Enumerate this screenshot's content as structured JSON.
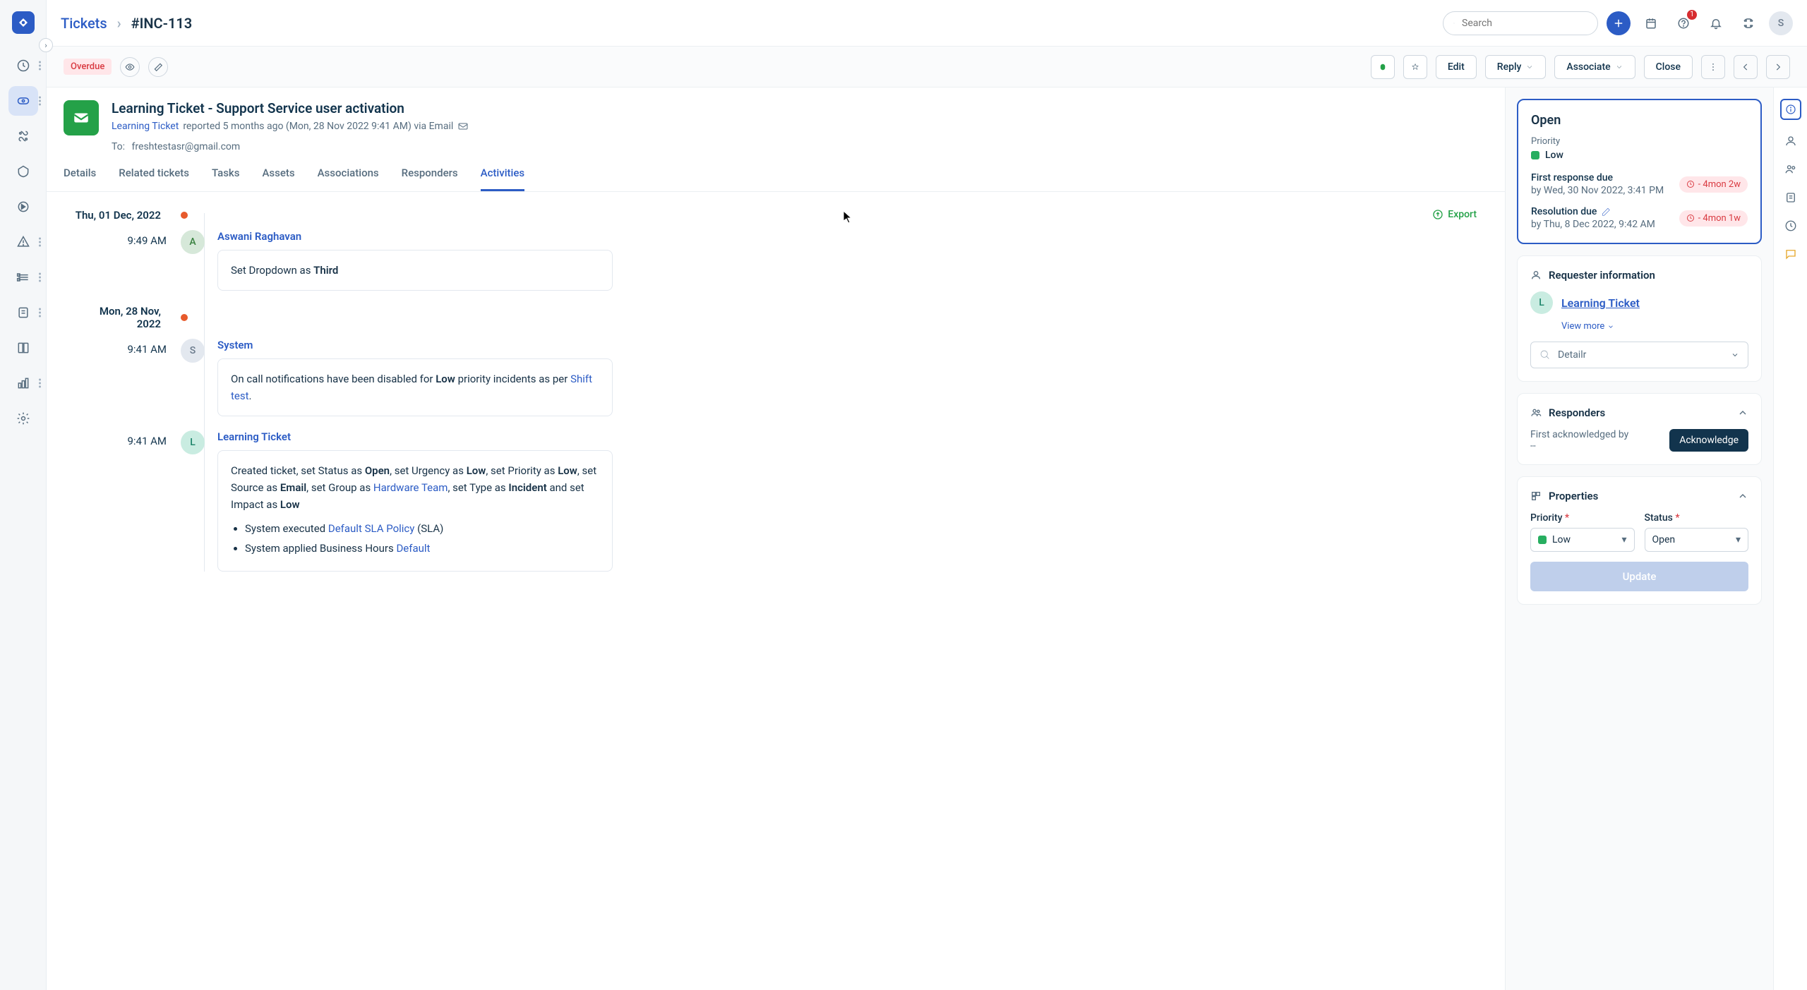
{
  "header": {
    "breadcrumb_root": "Tickets",
    "breadcrumb_id": "#INC-113",
    "search_placeholder": "Search",
    "notification_count": "1",
    "avatar_initial": "S"
  },
  "action_bar": {
    "overdue": "Overdue",
    "edit": "Edit",
    "reply": "Reply",
    "associate": "Associate",
    "close": "Close"
  },
  "ticket": {
    "title": "Learning Ticket - Support Service user activation",
    "reporter_link": "Learning Ticket",
    "reported_meta": " reported 5 months ago (Mon, 28 Nov 2022 9:41 AM) via Email",
    "to_label": "To:",
    "to_value": "freshtestasr@gmail.com"
  },
  "tabs": {
    "details": "Details",
    "related": "Related tickets",
    "tasks": "Tasks",
    "assets": "Assets",
    "associations": "Associations",
    "responders": "Responders",
    "activities": "Activities"
  },
  "activities": {
    "export": "Export",
    "days": [
      {
        "date": "Thu, 01 Dec, 2022",
        "events": [
          {
            "time": "9:49 AM",
            "avatar": "A",
            "avatar_class": "av-a",
            "author": "Aswani Raghavan",
            "html_pre": "Set Dropdown as ",
            "html_bold": "Third"
          }
        ]
      },
      {
        "date": "Mon, 28 Nov, 2022",
        "events": [
          {
            "time": "9:41 AM",
            "avatar": "S",
            "avatar_class": "av-s",
            "author": "System",
            "desc_1": "On call notifications have been disabled for ",
            "desc_bold1": "Low",
            "desc_2": " priority incidents as per ",
            "desc_link": "Shift test",
            "desc_3": "."
          },
          {
            "time": "9:41 AM",
            "avatar": "L",
            "avatar_class": "av-l",
            "author": "Learning Ticket",
            "created": {
              "t1": "Created ticket, set Status as ",
              "b1": "Open",
              "t2": ", set Urgency as ",
              "b2": "Low",
              "t3": ", set Priority as ",
              "b3": "Low",
              "t4": ", set Source as ",
              "b4": "Email",
              "t5": ", set Group as ",
              "l1": "Hardware Team",
              "t6": ", set Type as ",
              "b5": "Incident",
              "t7": " and set Impact as ",
              "b6": "Low",
              "li1_a": "System executed ",
              "li1_l": "Default SLA Policy",
              "li1_b": " (SLA)",
              "li2_a": "System applied Business Hours ",
              "li2_l": "Default"
            }
          }
        ]
      }
    ]
  },
  "side": {
    "status": "Open",
    "priority_lbl": "Priority",
    "priority_val": "Low",
    "first_response_lbl": "First response due",
    "first_response_val": "by Wed, 30 Nov 2022, 3:41 PM",
    "first_response_overdue": "- 4mon 2w",
    "resolution_lbl": "Resolution due",
    "resolution_val": "by Thu, 8 Dec 2022, 9:42 AM",
    "resolution_overdue": "- 4mon 1w",
    "requester_hdr": "Requester information",
    "requester_name": "Learning Ticket",
    "view_more": "View more",
    "detail_placeholder": "Detailr",
    "responders_hdr": "Responders",
    "ack_label": "First acknowledged by",
    "ack_val": "--",
    "ack_btn": "Acknowledge",
    "properties_hdr": "Properties",
    "prop_priority_lbl": "Priority",
    "prop_priority_val": "Low",
    "prop_status_lbl": "Status",
    "prop_status_val": "Open",
    "update_btn": "Update"
  }
}
